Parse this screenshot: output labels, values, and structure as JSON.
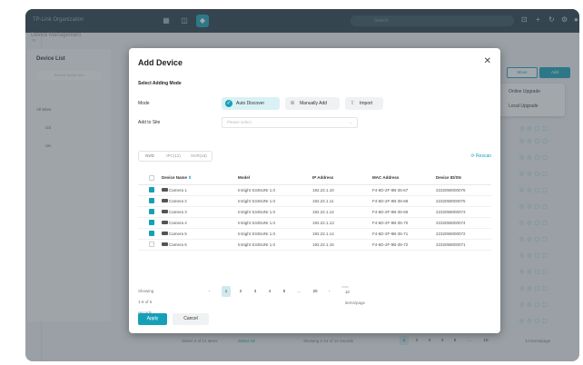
{
  "topbar": {
    "org": "TP-Link Organization",
    "search_placeholder": "Search",
    "tab_icons": [
      "grid-icon",
      "dashboard-icon",
      "devices-icon"
    ]
  },
  "background": {
    "breadcrumb": "Device Management",
    "device_list": {
      "title": "Device List",
      "search_placeholder": "Search device info",
      "tree": [
        "All Sites",
        "US",
        "UK"
      ]
    },
    "buttons": {
      "move": "Move",
      "add": "Add"
    },
    "context_menu": [
      "Online Upgrade",
      "Local Upgrade"
    ],
    "footer": {
      "selected": "Select 2 of 14 items",
      "select_all": "Select All",
      "showing": "Showing 1-12 of 14 records",
      "pages": [
        "1",
        "2",
        "3",
        "4",
        "5",
        "...",
        "10"
      ],
      "per_page": "14 items/page"
    }
  },
  "modal": {
    "title": "Add Device",
    "section": "Select Adding Mode",
    "mode_label": "Mode",
    "modes": [
      {
        "label": "Auto Discover",
        "selected": true
      },
      {
        "label": "Manually Add",
        "selected": false
      },
      {
        "label": "Import",
        "selected": false
      }
    ],
    "site_label": "Add to Site",
    "site_placeholder": "Please select",
    "tabs": [
      "NVD",
      "IPC(12)",
      "NVR(18)"
    ],
    "rescan": "Rescan",
    "columns": [
      "Device Name",
      "Model",
      "IP Address",
      "MAC Address",
      "Device ID/SN"
    ],
    "rows": [
      {
        "checked": true,
        "name": "Camera 1",
        "model": "InSight S345UNI 1.0",
        "ip": "192.22.1.10",
        "mac": "F4-6D-2F-9B-35-67",
        "sn": "2232059000076"
      },
      {
        "checked": true,
        "name": "Camera 2",
        "model": "InSight S345UNI 1.0",
        "ip": "192.22.1.11",
        "mac": "F4-6D-2F-9B-35-68",
        "sn": "2232059000075"
      },
      {
        "checked": true,
        "name": "Camera 3",
        "model": "InSight S345UNI 1.0",
        "ip": "192.22.1.12",
        "mac": "F4-6D-2F-9B-35-69",
        "sn": "2232059000073"
      },
      {
        "checked": true,
        "name": "Camera 4",
        "model": "InSight S345UNI 1.0",
        "ip": "192.22.1.13",
        "mac": "F4-6D-2F-9B-35-70",
        "sn": "2232059000074"
      },
      {
        "checked": true,
        "name": "Camera 5",
        "model": "InSight S345UNI 1.0",
        "ip": "192.22.1.14",
        "mac": "F4-6D-2F-9B-35-71",
        "sn": "2232059000072"
      },
      {
        "checked": false,
        "name": "Camera 6",
        "model": "InSight S345UNI 1.0",
        "ip": "192.22.1.15",
        "mac": "F4-6D-2F-9B-35-72",
        "sn": "2232059000071"
      }
    ],
    "pager": {
      "showing": "Showing 1-6 of 6 records",
      "pages": [
        "1",
        "2",
        "3",
        "4",
        "5",
        "...",
        "20"
      ],
      "per_page": "10 items/page"
    },
    "apply": "Apply",
    "cancel": "Cancel"
  },
  "colors": {
    "accent": "#15a0b8",
    "topbar": "#243b47"
  }
}
